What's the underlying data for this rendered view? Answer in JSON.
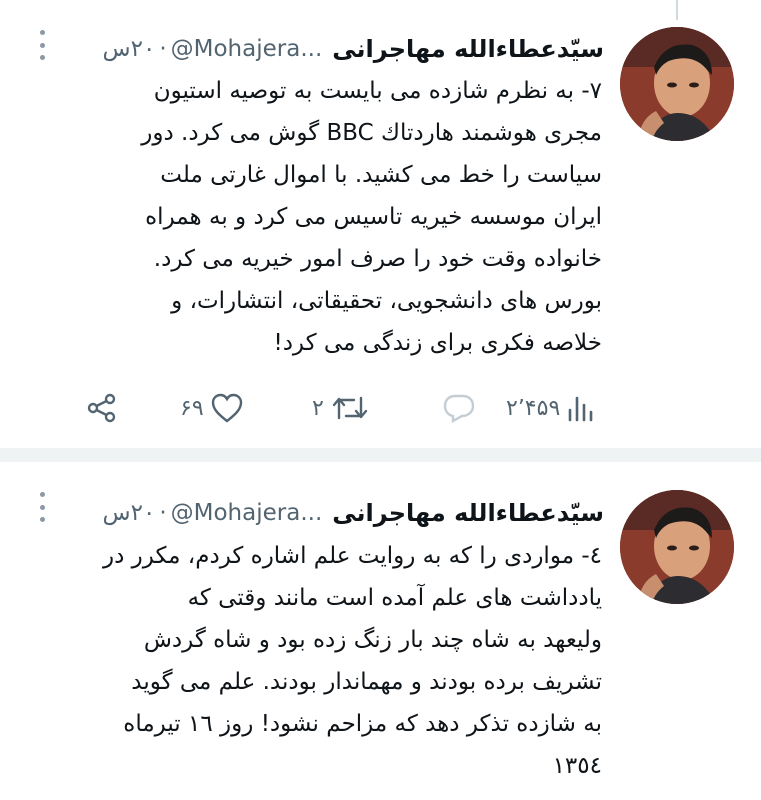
{
  "tweets": [
    {
      "author_name": "سیّدعطاءالله مهاجرانی",
      "handle": "@Mohajera...",
      "time": "۲۰س",
      "body_lines": [
        "۷- به نظرم شازده می بایست به توصیه استیون",
        "مجری هوشمند هاردتاك BBC گوش می کرد. دور",
        "سیاست را خط می کشید. با اموال غارتی ملت",
        "ایران موسسه خیریه تاسیس می کرد و به همراه",
        "خانواده وقت خود را صرف امور خیریه می کرد.",
        "بورس های دانشجویی، تحقیقاتی، انتشارات، و",
        "خلاصه فکری برای زندگی می کرد!"
      ],
      "stats": {
        "views": "۲٬۴۵۹",
        "retweets": "۲",
        "likes": "۶۹"
      },
      "icons": {
        "views": "bar-chart-icon",
        "reply": "reply-bubble-icon",
        "retweet": "retweet-icon",
        "like": "heart-icon",
        "share": "share-icon",
        "more": "more-vertical-icon"
      }
    },
    {
      "author_name": "سیّدعطاءالله مهاجرانی",
      "handle": "@Mohajera...",
      "time": "۲۰س",
      "body_lines": [
        "٤- مواردی را که به روایت علم اشاره کردم، مکرر در",
        "یادداشت های علم آمده است  مانند وقتی که",
        "ولیعهد به شاه چند بار زنگ زده بود و شاه گردش",
        "تشریف برده بودند و مهماندار بودند. علم می گوید",
        "به شازده تذکر دهد که مزاحم نشود! روز ۱٦ تیرماه",
        "۱۳٥٤"
      ]
    }
  ],
  "colors": {
    "text": "#0f1419",
    "muted": "#536471",
    "divider": "#eff3f4"
  }
}
